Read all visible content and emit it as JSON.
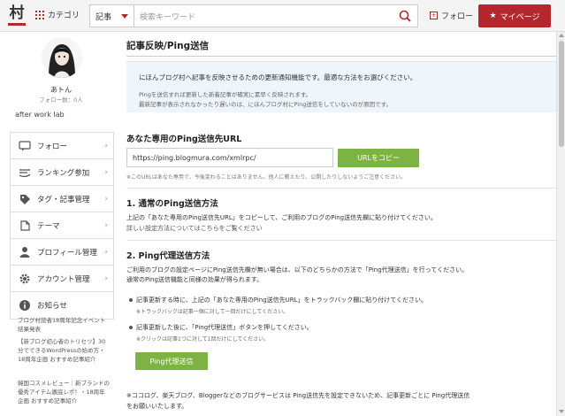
{
  "header": {
    "logo_text": "村",
    "category_label": "カテゴリ",
    "search_select": "記事",
    "search_placeholder": "検索キーワード",
    "follow_label": "フォロー",
    "mypage_label": "マイページ",
    "accent_color": "#b4282d"
  },
  "sidebar": {
    "user_name": "あトん",
    "follower_count": "フォロー数：0人",
    "blog_name": "after work lab",
    "menu": [
      {
        "label": "フォロー",
        "icon": "chat-bubble-icon"
      },
      {
        "label": "ランキング参加",
        "icon": "ranking-icon"
      },
      {
        "label": "タグ・記事管理",
        "icon": "tag-icon"
      },
      {
        "label": "テーマ",
        "icon": "theme-icon"
      },
      {
        "label": "プロフィール管理",
        "icon": "user-icon"
      },
      {
        "label": "アカウント管理",
        "icon": "gear-icon"
      },
      {
        "label": "お知らせ",
        "icon": "info-icon"
      }
    ],
    "news": [
      "ブログ村読者18周年記念イベント 結果発表",
      "【新ブログ初心者のトリセツ】30分でできるWordPressの始め方・18周年企画 おすすめ記事紹介",
      "韓国コスメレビュー｜新ブランドの優秀アイテム徹底レポ！・18周年企画 おすすめ記事紹介"
    ]
  },
  "main": {
    "page_title": "記事反映/Ping送信",
    "notice_lead": "にほんブログ村へ記事を反映させるための更新通知機能です。最適な方法をお選びください。",
    "notice_sub1": "Pingを送信すれば更新した新着記事が確実に素早く反映されます。",
    "notice_sub2": "最新記事が表示されなかったり遅いのは、にほんブログ村にPing送信をしていないのが原因です。",
    "url_section_title": "あなた専用のPing送信先URL",
    "ping_url": "https://ping.blogmura.com/xmlrpc/",
    "copy_button": "URLをコピー",
    "url_note": "※このURLはあなた専用で、今後変わることはありません。他人に教えたり、公開したりしないようご注意ください。",
    "section1_title": "1. 通常のPing送信方法",
    "section1_text": "上記の「あなた専用のPing送信先URL」をコピーして、ご利用のブログのPing送信先欄に貼り付けてください。",
    "section1_link": "詳しい設定方法についてはこちらをご覧ください",
    "section2_title": "2. Ping代理送信方法",
    "section2_text1": "ご利用のブログの設定ページにPing送信先欄が無い場合は、以下のどちらかの方法で「Ping代理送信」を行ってください。",
    "section2_text2": "通常のPing送信機能と同様の効果が得られます。",
    "bullet1": "記事更新する時に、上記の「あなた専用のPing送信先URL」をトラックバック欄に貼り付けてください。",
    "bullet1_sub": "※トラックバックは記事一個に対して一回だけにしてください。",
    "bullet2": "記事更新した後に、「Ping代理送信」ボタンを押してください。",
    "bullet2_sub": "※クリックは記事1つに対して1回だけにしてください。",
    "ping_button": "Ping代理送信",
    "footer_note1": "※ココログ、楽天ブログ、Bloggerなどのブログサービスは Ping送信先を設定できないため、記事更新ごとに Ping代理送信",
    "footer_note2": "をお願いいたします。",
    "button_color": "#7cb342"
  }
}
